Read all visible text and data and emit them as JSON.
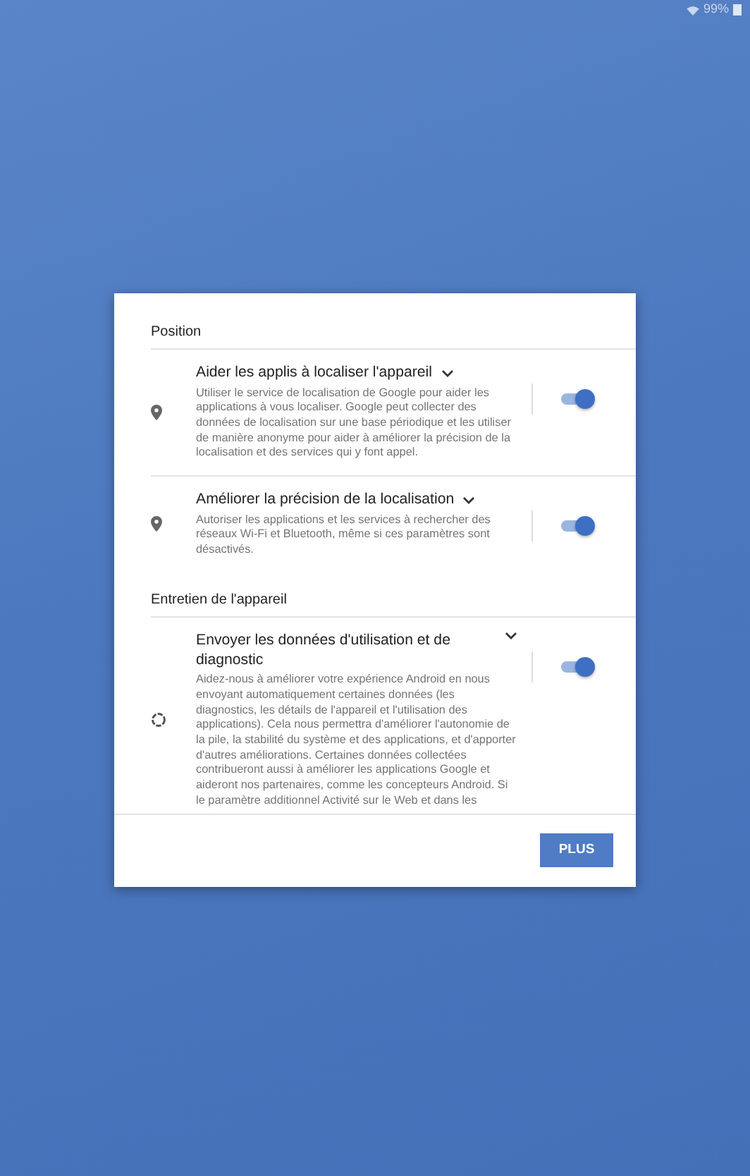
{
  "status_bar": {
    "battery": "99%"
  },
  "sections": [
    {
      "title": "Position",
      "items": [
        {
          "kind": "location",
          "title": "Aider les applis à localiser l'appareil",
          "description": "Utiliser le service de localisation de Google pour aider les applications à vous localiser. Google peut collecter des données de localisation sur une base périodique et les utiliser de manière anonyme pour aider à améliorer la précision de la localisation et des services qui y font appel.",
          "on": true
        },
        {
          "kind": "location",
          "title": "Améliorer la précision de la localisation",
          "description": "Autoriser les applications et les services à rechercher des réseaux Wi-Fi et Bluetooth, même si ces paramètres sont désactivés.",
          "on": true
        }
      ]
    },
    {
      "title": "Entretien de l'appareil",
      "items": [
        {
          "kind": "diagnostic",
          "title": "Envoyer les données d'utilisation et de diagnostic",
          "description": "Aidez-nous à améliorer votre expérience Android en nous envoyant automatiquement certaines données (les diagnostics, les détails de l'appareil et l'utilisation des applications). Cela nous permettra d'améliorer l'autonomie de la pile, la stabilité du système et des applications, et d'apporter d'autres améliorations. Certaines données collectées contribueront aussi à améliorer les applications Google et aideront nos partenaires, comme les concepteurs Android. Si le paramètre additionnel Activité sur le Web et dans les",
          "on": true
        }
      ]
    }
  ],
  "button": "PLUS"
}
